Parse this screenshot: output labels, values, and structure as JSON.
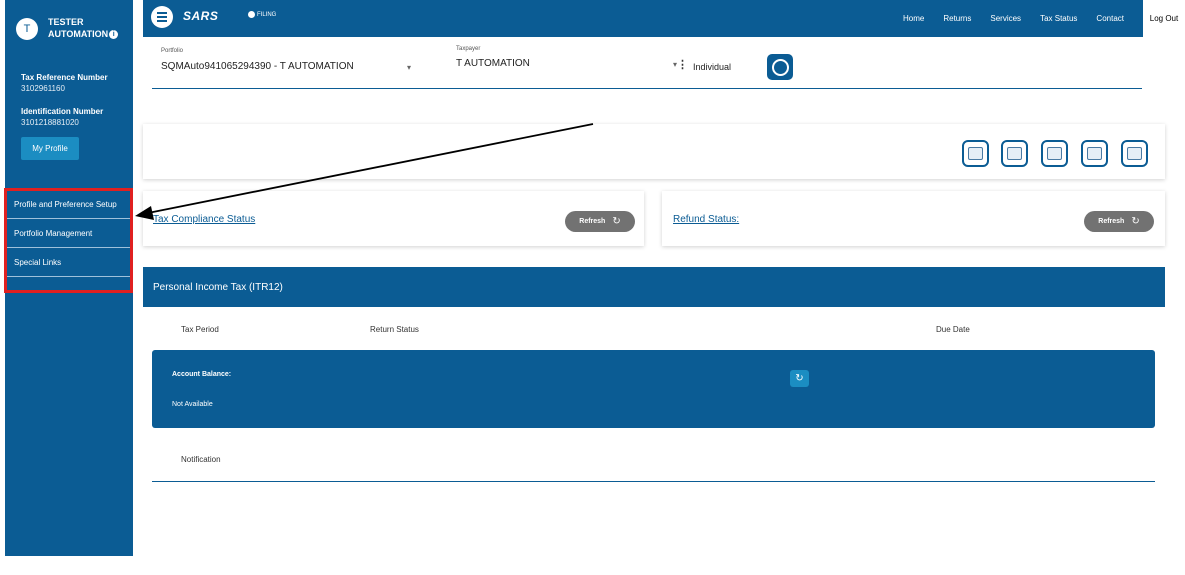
{
  "user": {
    "avatar_initial": "T",
    "name_line1": "TESTER",
    "name_line2": "AUTOMATION",
    "info_glyph": "i",
    "tax_ref_label": "Tax Reference Number",
    "tax_ref_value": "3102961160",
    "id_label": "Identification Number",
    "id_value": "3101218881020",
    "profile_button": "My Profile"
  },
  "sidebar": {
    "items": [
      {
        "label": "Profile and Preference Setup"
      },
      {
        "label": "Portfolio Management"
      },
      {
        "label": "Special Links"
      }
    ]
  },
  "topbar": {
    "brand": "SARS",
    "brand_sub": "FILING",
    "nav": [
      "Home",
      "Returns",
      "Services",
      "Tax Status",
      "Contact"
    ],
    "logout": "Log Out"
  },
  "portfolio": {
    "label": "Portfolio",
    "value": "SQMAuto941065294390 - T AUTOMATION",
    "taxpayer_label": "Taxpayer",
    "taxpayer_value": "T AUTOMATION",
    "taxpayer_type": "Individual",
    "kebab": "⋮",
    "caret": "▾"
  },
  "status": {
    "compliance_link": "Tax Compliance Status",
    "refund_link": "Refund Status:",
    "refresh_label": "Refresh",
    "refresh_glyph": "↻"
  },
  "itr": {
    "title": "Personal Income Tax (ITR12)",
    "col_period": "Tax Period",
    "col_status": "Return Status",
    "col_due": "Due Date",
    "balance_label": "Account Balance:",
    "balance_value": "Not Available",
    "notification": "Notification"
  },
  "colors": {
    "primary": "#0b5c94",
    "accent": "#1b8dc2",
    "highlight": "#e02020",
    "refresh_button": "#727272"
  },
  "icons": [
    "menu-icon",
    "taxpayer-badge-icon",
    "calculator-icon",
    "device-icon",
    "upload-icon",
    "print-icon",
    "document-icon",
    "refresh-icon",
    "arrow-annotation"
  ]
}
